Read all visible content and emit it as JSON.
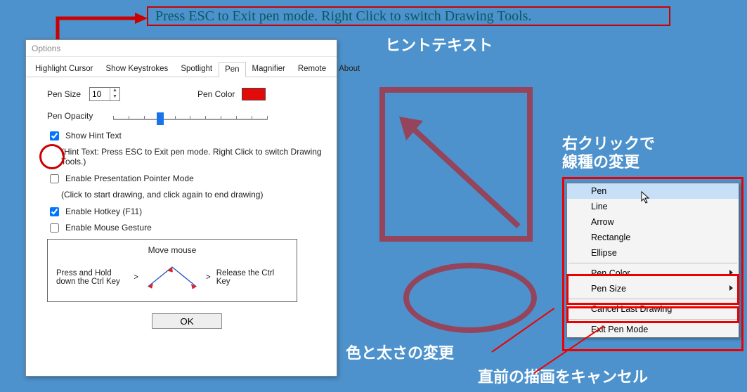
{
  "hint_bar": "Press ESC to Exit pen mode.  Right Click to switch Drawing Tools.",
  "dialog": {
    "title": "Options",
    "tabs": {
      "highlight": "Highlight Cursor",
      "keystrokes": "Show Keystrokes",
      "spotlight": "Spotlight",
      "pen": "Pen",
      "magnifier": "Magnifier",
      "remote": "Remote",
      "about": "About"
    },
    "pen_size_label": "Pen Size",
    "pen_size_value": "10",
    "pen_color_label": "Pen Color",
    "pen_color_value": "#e30a0a",
    "opacity_label": "Pen Opacity",
    "show_hint": {
      "label": "Show Hint Text",
      "sub": "(Hint Text: Press ESC to Exit pen mode.  Right Click to switch Drawing Tools.)"
    },
    "presentation": {
      "label": "Enable Presentation Pointer Mode",
      "sub": "(Click to start drawing, and click again to end drawing)"
    },
    "hotkey_label": "Enable Hotkey (F11)",
    "gesture_label": "Enable Mouse Gesture",
    "gesture_box": {
      "title": "Move mouse",
      "left": "Press and Hold down the Ctrl Key",
      "gt_arrow": ">",
      "right": "Release the Ctrl Key"
    },
    "ok": "OK"
  },
  "jp": {
    "hint": "ヒントテキスト",
    "right_click": "右クリックで\n線種の変更",
    "color_size": "色と太さの変更",
    "cancel": "直前の描画をキャンセル"
  },
  "menu": {
    "pen": "Pen",
    "line": "Line",
    "arrow": "Arrow",
    "rectangle": "Rectangle",
    "ellipse": "Ellipse",
    "pen_color": "Pen Color",
    "pen_size": "Pen Size",
    "cancel": "Cancel Last Drawing",
    "exit": "Exit Pen Mode"
  }
}
